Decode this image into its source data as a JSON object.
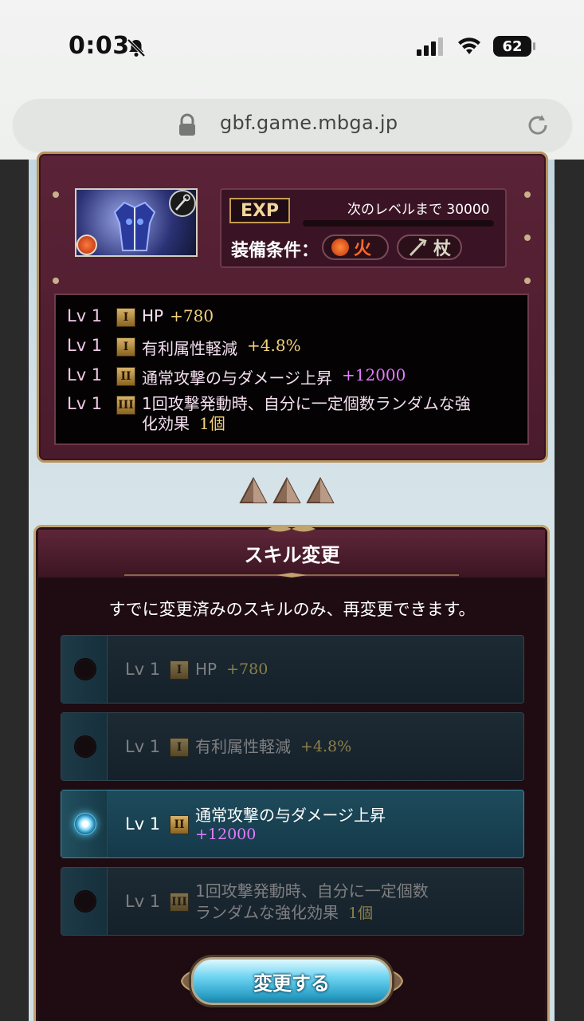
{
  "status_bar": {
    "time": "0:03",
    "battery": "62"
  },
  "browser": {
    "url": "gbf.game.mbga.jp"
  },
  "weapon": {
    "exp_label": "EXP",
    "exp_next": "次のレベルまで 30000",
    "exp_progress": 0,
    "equip_label": "装備条件：",
    "element": "火",
    "weapon_type": "杖",
    "skills": [
      {
        "lv": "Lv 1",
        "rank": "I",
        "name": "HP",
        "value": "+780",
        "value_color": "yellow"
      },
      {
        "lv": "Lv 1",
        "rank": "I",
        "name": "有利属性軽減",
        "value": "+4.8%",
        "value_color": "yellow"
      },
      {
        "lv": "Lv 1",
        "rank": "II",
        "name": "通常攻撃の与ダメージ上昇",
        "value": "+12000",
        "value_color": "purple"
      },
      {
        "lv": "Lv 1",
        "rank": "III",
        "name_line1": "1回攻撃発動時、自分に一定個数ランダムな強",
        "name_line2": "化効果",
        "value": "1個",
        "value_color": "yellow"
      }
    ]
  },
  "dialog": {
    "title": "スキル変更",
    "notice": "すでに変更済みのスキルのみ、再変更できます。",
    "options": [
      {
        "lv": "Lv 1",
        "rank": "I",
        "name": "HP",
        "value": "+780",
        "selected": false,
        "enabled": false
      },
      {
        "lv": "Lv 1",
        "rank": "I",
        "name": "有利属性軽減",
        "value": "+4.8%",
        "selected": false,
        "enabled": false
      },
      {
        "lv": "Lv 1",
        "rank": "II",
        "name": "通常攻撃の与ダメージ上昇",
        "value": "+12000",
        "selected": true,
        "enabled": true
      },
      {
        "lv": "Lv 1",
        "rank": "III",
        "name_line1": "1回攻撃発動時、自分に一定個数",
        "name_line2": "ランダムな強化効果",
        "value": "1個",
        "selected": false,
        "enabled": false
      }
    ],
    "submit_label": "変更する"
  },
  "colors": {
    "panel": "#4a1b2c",
    "gold": "#b7945e",
    "selected": "#1d4b5b",
    "accent_purple": "#e37cff",
    "accent_yellow": "#f2d27a"
  }
}
